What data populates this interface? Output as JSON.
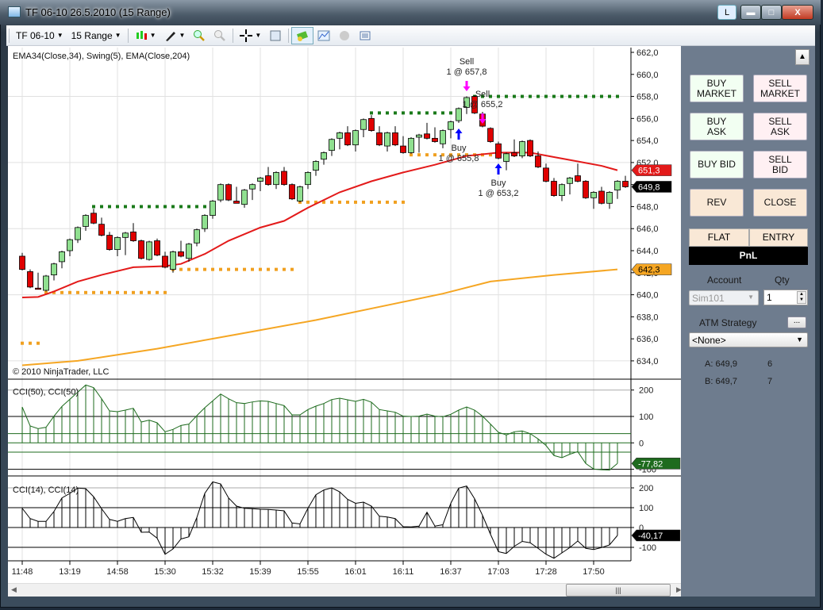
{
  "window": {
    "title": "TF 06-10  26.5.2010 (15 Range)",
    "l_button": "L",
    "close_glyph": "X"
  },
  "toolbar": {
    "instrument": "TF 06-10",
    "interval": "15 Range"
  },
  "chart": {
    "indicators_label": "EMA34(Close,34), Swing(5), EMA(Close,204)",
    "copyright": "© 2010 NinjaTrader, LLC",
    "price_labels": [
      "662,0",
      "660,0",
      "658,0",
      "656,0",
      "654,0",
      "652,0",
      "650,0",
      "648,0",
      "646,0",
      "644,0",
      "642,0",
      "640,0",
      "638,0",
      "636,0",
      "634,0"
    ],
    "markers": {
      "ema34": "651,3",
      "last": "649,8",
      "ema204": "642,3"
    },
    "cci50_label": "CCI(50), CCI(50)",
    "cci14_label": "CCI(14), CCI(14)",
    "cci_axis_labels": [
      "200",
      "100",
      "0",
      "-100"
    ],
    "cci50_marker": "-77,82",
    "cci14_marker": "-40,17",
    "time_labels": [
      "11:48",
      "13:19",
      "14:58",
      "15:30",
      "15:32",
      "15:39",
      "15:55",
      "16:01",
      "16:11",
      "16:37",
      "17:03",
      "17:28",
      "17:50"
    ],
    "trades": [
      {
        "label": "Sell",
        "detail": "1 @ 657,8",
        "side": "sell",
        "bar": 56
      },
      {
        "label": "Sell",
        "detail": "1 @ 655,2",
        "side": "sell",
        "bar": 58
      },
      {
        "label": "Buy",
        "detail": "1 @ 655,8",
        "side": "buy",
        "bar": 55
      },
      {
        "label": "Buy",
        "detail": "1 @ 653,2",
        "side": "buy",
        "bar": 60
      }
    ]
  },
  "chart_data": {
    "type": "candlestick",
    "ylim": [
      634,
      662
    ],
    "ohlc": [
      [
        643.5,
        643.8,
        642.2,
        642.3
      ],
      [
        642.1,
        642.3,
        640.6,
        640.7
      ],
      [
        640.6,
        642.0,
        640.5,
        640.5
      ],
      [
        640.4,
        641.8,
        640.3,
        641.7
      ],
      [
        641.8,
        642.9,
        641.3,
        642.8
      ],
      [
        643.0,
        644.0,
        642.4,
        643.9
      ],
      [
        644.0,
        645.1,
        643.5,
        645.0
      ],
      [
        645.0,
        646.2,
        644.7,
        646.1
      ],
      [
        646.2,
        647.3,
        645.8,
        647.2
      ],
      [
        647.4,
        647.8,
        646.4,
        646.5
      ],
      [
        646.4,
        647.0,
        645.3,
        645.4
      ],
      [
        645.4,
        645.7,
        644.0,
        644.1
      ],
      [
        644.1,
        645.3,
        643.5,
        645.2
      ],
      [
        645.2,
        645.7,
        643.6,
        645.6
      ],
      [
        645.7,
        646.5,
        644.8,
        644.9
      ],
      [
        644.9,
        645.0,
        643.2,
        643.3
      ],
      [
        643.2,
        644.9,
        643.1,
        644.8
      ],
      [
        644.9,
        645.1,
        643.5,
        643.6
      ],
      [
        643.5,
        643.9,
        642.4,
        642.5
      ],
      [
        642.3,
        644.0,
        642.0,
        643.9
      ],
      [
        643.9,
        644.9,
        643.4,
        643.5
      ],
      [
        643.3,
        644.7,
        643.0,
        644.6
      ],
      [
        644.7,
        646.0,
        644.4,
        645.9
      ],
      [
        646.0,
        647.3,
        645.7,
        647.2
      ],
      [
        647.2,
        648.6,
        646.9,
        648.5
      ],
      [
        648.6,
        650.1,
        648.4,
        650.0
      ],
      [
        650.0,
        650.1,
        648.5,
        648.6
      ],
      [
        648.5,
        649.8,
        648.3,
        648.3
      ],
      [
        648.2,
        649.6,
        647.9,
        649.5
      ],
      [
        649.6,
        650.1,
        648.6,
        650.0
      ],
      [
        650.3,
        650.7,
        649.4,
        650.6
      ],
      [
        650.8,
        651.6,
        649.9,
        650.0
      ],
      [
        650.0,
        651.2,
        649.6,
        651.1
      ],
      [
        651.2,
        651.6,
        649.9,
        650.0
      ],
      [
        650.0,
        650.1,
        648.6,
        648.7
      ],
      [
        648.5,
        649.9,
        648.4,
        649.8
      ],
      [
        650.0,
        651.2,
        649.6,
        651.1
      ],
      [
        651.3,
        652.2,
        650.8,
        652.1
      ],
      [
        652.3,
        653.0,
        651.8,
        652.9
      ],
      [
        653.1,
        654.2,
        652.6,
        654.1
      ],
      [
        654.2,
        654.8,
        653.2,
        654.7
      ],
      [
        654.7,
        655.3,
        653.5,
        653.6
      ],
      [
        653.6,
        655.0,
        653.0,
        654.9
      ],
      [
        655.0,
        656.0,
        654.3,
        655.9
      ],
      [
        656.0,
        656.3,
        654.8,
        654.9
      ],
      [
        654.7,
        655.3,
        653.5,
        653.6
      ],
      [
        653.5,
        654.8,
        653.0,
        654.7
      ],
      [
        654.7,
        655.3,
        653.5,
        653.6
      ],
      [
        653.5,
        654.4,
        652.8,
        652.9
      ],
      [
        652.9,
        654.3,
        652.8,
        654.2
      ],
      [
        654.3,
        654.6,
        652.9,
        654.5
      ],
      [
        654.6,
        655.6,
        654.1,
        654.2
      ],
      [
        654.2,
        655.2,
        653.8,
        653.9
      ],
      [
        653.7,
        655.0,
        653.3,
        654.9
      ],
      [
        655.0,
        655.8,
        654.2,
        655.7
      ],
      [
        655.8,
        657.0,
        655.6,
        656.9
      ],
      [
        657.0,
        658.0,
        656.4,
        657.9
      ],
      [
        658.0,
        658.1,
        656.4,
        656.5
      ],
      [
        656.4,
        656.6,
        655.2,
        655.3
      ],
      [
        655.1,
        655.2,
        653.8,
        653.9
      ],
      [
        653.7,
        653.9,
        652.3,
        652.4
      ],
      [
        652.1,
        652.9,
        651.3,
        652.8
      ],
      [
        652.9,
        654.1,
        652.5,
        652.6
      ],
      [
        652.6,
        654.0,
        652.4,
        653.9
      ],
      [
        654.0,
        654.1,
        652.5,
        652.6
      ],
      [
        652.6,
        653.0,
        651.5,
        651.6
      ],
      [
        651.5,
        651.9,
        650.2,
        650.3
      ],
      [
        650.3,
        650.6,
        648.9,
        649.0
      ],
      [
        649.0,
        650.1,
        648.5,
        650.0
      ],
      [
        650.1,
        650.7,
        649.1,
        650.6
      ],
      [
        650.8,
        651.9,
        650.2,
        650.3
      ],
      [
        650.3,
        650.4,
        648.7,
        648.8
      ],
      [
        648.8,
        649.4,
        647.8,
        649.3
      ],
      [
        649.4,
        649.8,
        648.2,
        648.3
      ],
      [
        648.3,
        649.4,
        647.8,
        649.3
      ],
      [
        649.5,
        650.4,
        648.7,
        650.3
      ],
      [
        650.3,
        650.8,
        649.7,
        649.8
      ]
    ],
    "ema34": [
      [
        0,
        639.75
      ],
      [
        2,
        639.8
      ],
      [
        4,
        640.3
      ],
      [
        7,
        641.2
      ],
      [
        10,
        641.8
      ],
      [
        14,
        642.5
      ],
      [
        18,
        642.6
      ],
      [
        20,
        642.8
      ],
      [
        23,
        643.7
      ],
      [
        26,
        644.9
      ],
      [
        30,
        646.1
      ],
      [
        33,
        646.7
      ],
      [
        36,
        647.9
      ],
      [
        40,
        649.3
      ],
      [
        44,
        650.3
      ],
      [
        48,
        651.1
      ],
      [
        52,
        651.8
      ],
      [
        56,
        652.6
      ],
      [
        60,
        652.9
      ],
      [
        64,
        652.9
      ],
      [
        67,
        652.5
      ],
      [
        70,
        652.1
      ],
      [
        73,
        651.7
      ],
      [
        75,
        651.3
      ]
    ],
    "ema204": [
      [
        0,
        633.6
      ],
      [
        7,
        634.0
      ],
      [
        17,
        635.1
      ],
      [
        27,
        636.4
      ],
      [
        37,
        637.7
      ],
      [
        47,
        639.2
      ],
      [
        53,
        640.1
      ],
      [
        59,
        641.2
      ],
      [
        67,
        641.8
      ],
      [
        75,
        642.3
      ]
    ],
    "swing_high": [
      [
        9,
        24,
        648.0
      ],
      [
        44,
        55,
        656.5
      ],
      [
        57,
        75,
        658.0
      ]
    ],
    "swing_low": [
      [
        0,
        2,
        635.6
      ],
      [
        3,
        18,
        640.2
      ],
      [
        19,
        34,
        642.3
      ],
      [
        35,
        48,
        648.4
      ],
      [
        49,
        63,
        652.7
      ]
    ],
    "cci50": [
      136,
      64,
      54,
      59,
      101,
      138,
      165,
      192,
      219,
      209,
      167,
      121,
      118,
      124,
      131,
      79,
      86,
      76,
      42,
      51,
      66,
      71,
      103,
      133,
      159,
      185,
      167,
      152,
      149,
      155,
      159,
      157,
      149,
      141,
      106,
      106,
      126,
      139,
      149,
      164,
      169,
      163,
      157,
      165,
      154,
      126,
      121,
      116,
      101,
      100,
      101,
      109,
      101,
      99,
      108,
      124,
      136,
      124,
      101,
      71,
      40,
      30,
      42,
      45,
      35,
      15,
      -10,
      -48,
      -56,
      -43,
      -33,
      -78,
      -99,
      -102,
      -103,
      -78
    ],
    "cci14": [
      97,
      45,
      31,
      31,
      81,
      149,
      172,
      199,
      196,
      155,
      95,
      41,
      31,
      45,
      51,
      -24,
      -23,
      -54,
      -135,
      -108,
      -58,
      -47,
      50,
      172,
      230,
      220,
      149,
      108,
      97,
      95,
      92,
      91,
      88,
      84,
      23,
      18,
      97,
      165,
      189,
      200,
      180,
      142,
      122,
      128,
      108,
      57,
      53,
      45,
      4,
      3,
      7,
      77,
      7,
      14,
      122,
      199,
      209,
      145,
      61,
      -34,
      -122,
      -131,
      -95,
      -70,
      -77,
      -105,
      -135,
      -155,
      -128,
      -101,
      -68,
      -105,
      -111,
      -101,
      -88,
      -40
    ],
    "time_label_bars": [
      0,
      6,
      12,
      18,
      24,
      30,
      36,
      42,
      48,
      54,
      60,
      66,
      72
    ]
  },
  "panel": {
    "buttons": [
      {
        "label": "BUY MARKET",
        "kind": "buy"
      },
      {
        "label": "SELL MARKET",
        "kind": "sell"
      },
      {
        "label": "BUY ASK",
        "kind": "buy"
      },
      {
        "label": "SELL ASK",
        "kind": "sell"
      },
      {
        "label": "BUY BID",
        "kind": "buy"
      },
      {
        "label": "SELL BID",
        "kind": "sell"
      },
      {
        "label": "REV",
        "kind": "neu"
      },
      {
        "label": "CLOSE",
        "kind": "neu"
      }
    ],
    "flat": "FLAT",
    "entry": "ENTRY",
    "pnl": "PnL",
    "account_label": "Account",
    "qty_label": "Qty",
    "account": "Sim101",
    "qty": "1",
    "atm_label": "ATM Strategy",
    "atm_more": "...",
    "atm_value": "<None>",
    "ask": "A: 649,9",
    "ask_size": "6",
    "bid": "B: 649,7",
    "bid_size": "7"
  },
  "colors": {
    "up": "#90e090",
    "down": "#e00000",
    "ema34": "#e31a1a",
    "ema204": "#f5a623",
    "swing_high": "#1a7a1a",
    "swing_low": "#f0a020",
    "cci50": "#1e6b1e",
    "sell_arrow": "#ff00ff",
    "buy_arrow": "#0000ff"
  }
}
